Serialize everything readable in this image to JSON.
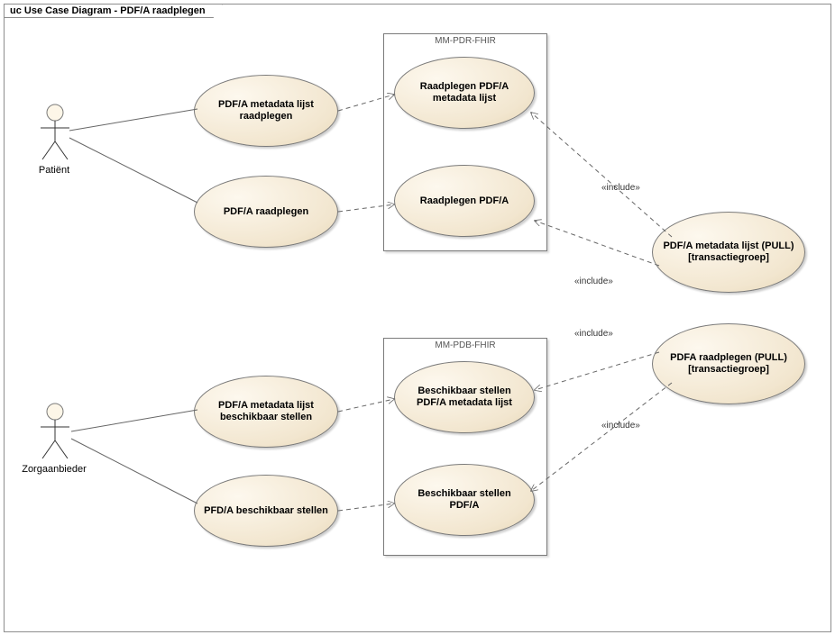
{
  "frame": {
    "title": "uc Use Case Diagram - PDF/A raadplegen"
  },
  "actors": {
    "patient": "Patiënt",
    "zorgaanbieder": "Zorgaanbieder"
  },
  "boundaries": {
    "pdr": "MM-PDR-FHIR",
    "pdb": "MM-PDB-FHIR"
  },
  "usecases": {
    "uc1": "PDF/A metadata lijst raadplegen",
    "uc2": "PDF/A raadplegen",
    "uc3": "Raadplegen PDF/A metadata lijst",
    "uc4": "Raadplegen PDF/A",
    "uc5": "PDF/A metadata lijst beschikbaar stellen",
    "uc6": "PFD/A beschikbaar stellen",
    "uc7": "Beschikbaar stellen PDF/A metadata lijst",
    "uc8": "Beschikbaar stellen PDF/A",
    "uc9": "PDF/A metadata lijst (PULL) [transactiegroep]",
    "uc10": "PDFA raadplegen (PULL) [transactiegroep]"
  },
  "labels": {
    "include": "«include»"
  }
}
